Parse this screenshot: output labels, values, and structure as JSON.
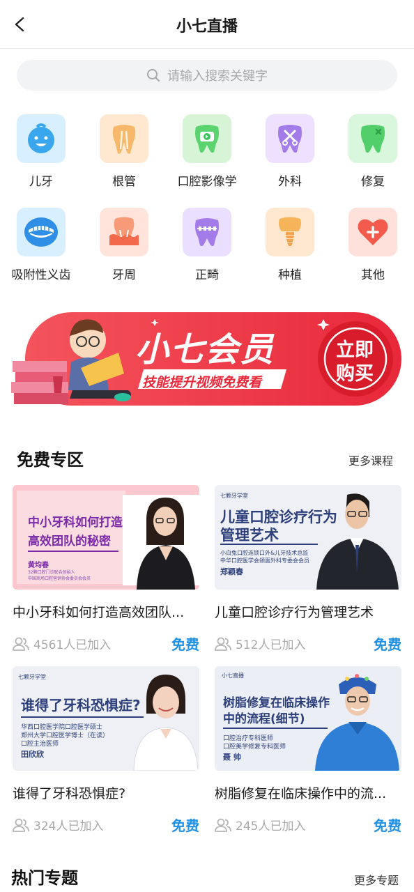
{
  "header": {
    "title": "小七直播"
  },
  "search": {
    "placeholder": "请输入搜索关键字"
  },
  "categories": [
    {
      "label": "儿牙",
      "icon": "baby-face-icon",
      "bg": "#d8efff",
      "color": "#3aa6ee"
    },
    {
      "label": "根管",
      "icon": "tooth-root-icon",
      "bg": "#ffe8cf",
      "color": "#f2a24a"
    },
    {
      "label": "口腔影像学",
      "icon": "tooth-video-icon",
      "bg": "#d7f5d6",
      "color": "#3cc55b"
    },
    {
      "label": "外科",
      "icon": "surgery-tooth-icon",
      "bg": "#eee1ff",
      "color": "#9a68e6"
    },
    {
      "label": "修复",
      "icon": "repair-tooth-icon",
      "bg": "#d9f7dd",
      "color": "#43c765"
    },
    {
      "label": "吸附性义齿",
      "icon": "denture-icon",
      "bg": "#d8efff",
      "color": "#2f8fe6"
    },
    {
      "label": "牙周",
      "icon": "gum-tooth-icon",
      "bg": "#ffe4dc",
      "color": "#f47a55"
    },
    {
      "label": "正畸",
      "icon": "braces-tooth-icon",
      "bg": "#eadfff",
      "color": "#9a6be6"
    },
    {
      "label": "种植",
      "icon": "implant-icon",
      "bg": "#ffe8cf",
      "color": "#f4a24b"
    },
    {
      "label": "其他",
      "icon": "heart-plus-icon",
      "bg": "#ffe1dc",
      "color": "#f25b4e"
    }
  ],
  "banner": {
    "title": "小七会员",
    "subtitle": "技能提升视频免费看",
    "cta_line1": "立即",
    "cta_line2": "购买"
  },
  "free_section": {
    "title": "免费专区",
    "more": "更多课程"
  },
  "hot_section": {
    "title": "热门专题",
    "more": "更多专题"
  },
  "courses": [
    {
      "title": "中小牙科如何打造高效团队...",
      "joined": "4561人已加入",
      "price": "免费",
      "thumb": {
        "headline1": "中小牙科如何打造",
        "headline2": "高效团队的秘密",
        "speaker": "黄均春",
        "line1": "32颗口腔门诊联合创始人",
        "line2": "中国商场口腔营销协会委员会会员"
      }
    },
    {
      "title": "儿童口腔诊疗行为管理艺术",
      "joined": "512人已加入",
      "price": "免费",
      "thumb": {
        "brand": "七颗牙学堂",
        "headline1": "儿童口腔诊疗行为",
        "headline2": "管理艺术",
        "line1": "小白兔口腔连锁口外&儿牙技术总监",
        "line2": "中华口腔医学会颌面外科专委会会员",
        "speaker": "郑颖春"
      }
    },
    {
      "title": "谁得了牙科恐惧症?",
      "joined": "324人已加入",
      "price": "免费",
      "thumb": {
        "brand": "七颗牙学堂",
        "headline1": "谁得了牙科恐惧症?",
        "line1": "华西口腔医学院口腔医学硕士",
        "line2": "郑州大学口腔医学博士（在读）",
        "line3": "口腔主治医师",
        "speaker": "田欣欣"
      }
    },
    {
      "title": "树脂修复在临床操作中的流...",
      "joined": "245人已加入",
      "price": "免费",
      "thumb": {
        "brand": "小七直播",
        "headline1": "树脂修复在临床操作",
        "headline2": "中的流程(细节)",
        "line1": "口腔治疗专科医师",
        "line2": "口腔美学修复专科医师",
        "speaker": "聂 帅"
      }
    }
  ],
  "colors": {
    "accent": "#1e90e6",
    "banner_red": "#ef3340"
  }
}
